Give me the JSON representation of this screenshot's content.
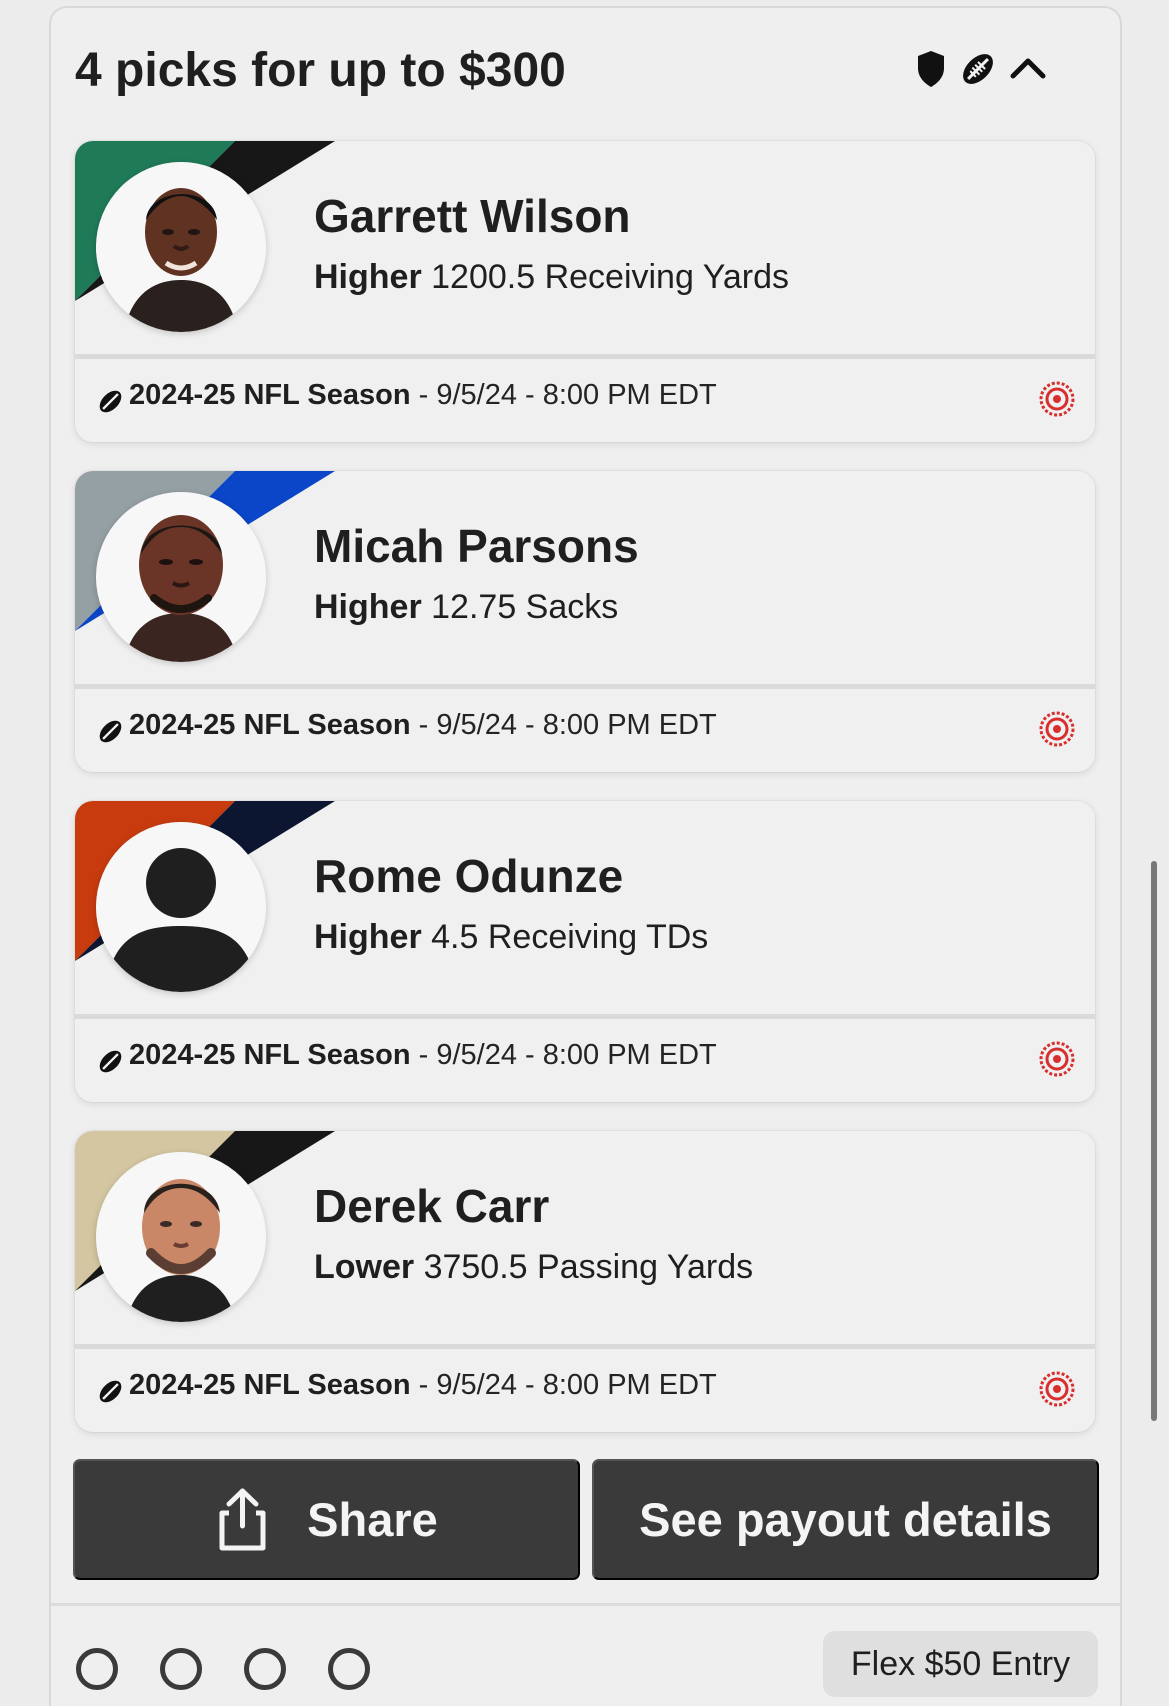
{
  "entry": {
    "title": "4 picks for up to $300",
    "header_icons": [
      "shield-icon",
      "football-icon",
      "chevron-up-icon"
    ],
    "entry_type": "Flex $50 Entry"
  },
  "picks": [
    {
      "player": "Garrett Wilson",
      "direction": "Higher",
      "projection": "1200.5 Receiving Yards",
      "season": "2024-25 NFL Season",
      "schedule": " - 9/5/24 - 8:00 PM EDT",
      "team_colors": [
        "#1f7a58",
        "#171717"
      ],
      "avatar": "player-photo"
    },
    {
      "player": "Micah Parsons",
      "direction": "Higher",
      "projection": "12.75 Sacks",
      "season": "2024-25 NFL Season",
      "schedule": " - 9/5/24 - 8:00 PM EDT",
      "team_colors": [
        "#95a0a4",
        "#0b45c8"
      ],
      "avatar": "player-photo"
    },
    {
      "player": "Rome Odunze",
      "direction": "Higher",
      "projection": "4.5 Receiving TDs",
      "season": "2024-25 NFL Season",
      "schedule": " - 9/5/24 - 8:00 PM EDT",
      "team_colors": [
        "#c83b0f",
        "#0d1630"
      ],
      "avatar": "generic-avatar-icon"
    },
    {
      "player": "Derek Carr",
      "direction": "Lower",
      "projection": "3750.5 Passing Yards",
      "season": "2024-25 NFL Season",
      "schedule": " - 9/5/24 - 8:00 PM EDT",
      "team_colors": [
        "#d4c6a1",
        "#171717"
      ],
      "avatar": "player-photo"
    }
  ],
  "actions": {
    "share": "Share",
    "payout": "See payout details"
  },
  "progress": {
    "total_steps": 4,
    "selected_steps": 0
  },
  "colors": {
    "button": "#3a3a3a",
    "target_red": "#d82e2e",
    "panel": "#efefef"
  }
}
